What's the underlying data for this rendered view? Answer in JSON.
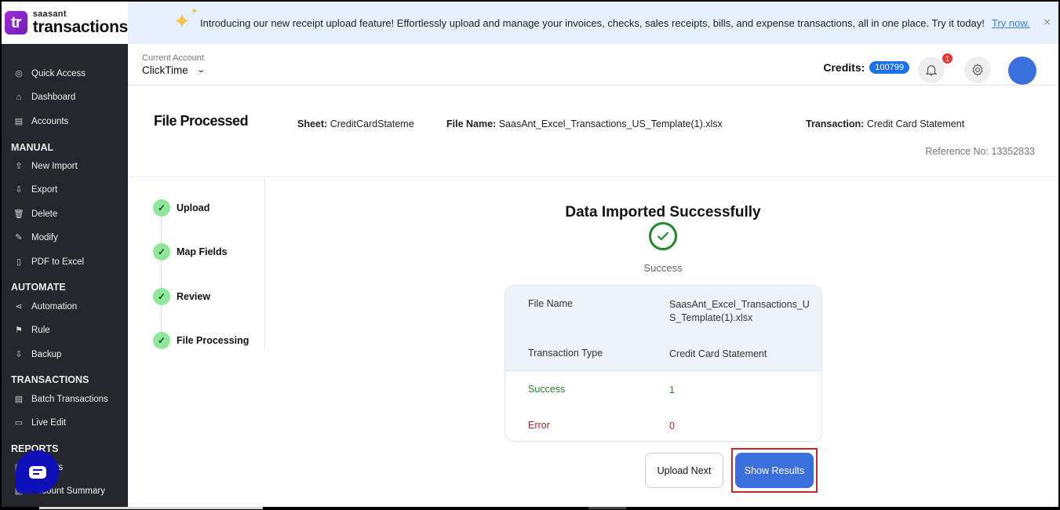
{
  "logo": {
    "mark": "tr",
    "small": "saasant",
    "big": "transactions"
  },
  "banner": {
    "text": "Introducing our new receipt upload feature! Effortlessly upload and manage your invoices, checks, sales receipts, bills, and expense transactions, all in one place. Try it today!",
    "link": "Try now.",
    "close": "×"
  },
  "sidebar": {
    "items": [
      {
        "label": "Quick Access",
        "icon": "◎"
      },
      {
        "label": "Dashboard",
        "icon": "⌂"
      },
      {
        "label": "Accounts",
        "icon": "▤"
      }
    ],
    "sections": [
      {
        "title": "MANUAL",
        "items": [
          {
            "label": "New Import",
            "icon": "⇧"
          },
          {
            "label": "Export",
            "icon": "⇩"
          },
          {
            "label": "Delete",
            "icon": "🗑"
          },
          {
            "label": "Modify",
            "icon": "✎"
          },
          {
            "label": "PDF to Excel",
            "icon": "▯"
          }
        ]
      },
      {
        "title": "AUTOMATE",
        "items": [
          {
            "label": "Automation",
            "icon": "⋖"
          },
          {
            "label": "Rule",
            "icon": "⚑"
          },
          {
            "label": "Backup",
            "icon": "⇩"
          }
        ]
      },
      {
        "title": "TRANSACTIONS",
        "items": [
          {
            "label": "Batch Transactions",
            "icon": "▤"
          },
          {
            "label": "Live Edit",
            "icon": "▭"
          }
        ]
      },
      {
        "title": "REPORTS",
        "items": [
          {
            "label": "Reports",
            "icon": "▤"
          },
          {
            "label": "Account Summary",
            "icon": "▤"
          }
        ]
      }
    ]
  },
  "header": {
    "account_label": "Current Account",
    "account_value": "ClickTime",
    "credits_label": "Credits:",
    "credits_value": "100799",
    "notification_count": "1"
  },
  "info": {
    "title": "File Processed",
    "sheet_label": "Sheet:",
    "sheet_value": "CreditCardStateme",
    "file_label": "File Name:",
    "file_value": "SaasAnt_Excel_Transactions_US_Template(1).xlsx",
    "transaction_label": "Transaction:",
    "transaction_value": "Credit Card Statement",
    "reference": "Reference No: 13352833"
  },
  "steps": [
    {
      "label": "Upload",
      "status": "done"
    },
    {
      "label": "Map Fields",
      "status": "done"
    },
    {
      "label": "Review",
      "status": "done"
    },
    {
      "label": "File Processing",
      "status": "done"
    }
  ],
  "result": {
    "title": "Data Imported Successfully",
    "status": "Success",
    "rows": [
      {
        "label": "File Name",
        "value": "SaasAnt_Excel_Transactions_US_Template(1).xlsx"
      },
      {
        "label": "Transaction Type",
        "value": "Credit Card Statement"
      },
      {
        "label": "Success",
        "value": "1"
      },
      {
        "label": "Error",
        "value": "0"
      }
    ]
  },
  "buttons": {
    "upload_next": "Upload Next",
    "show_results": "Show Results"
  },
  "colors": {
    "primary": "#3b6fde",
    "success": "#2e7d32",
    "error": "#b3262d",
    "step_done": "#8ee79a",
    "sidebar_bg": "#25272d",
    "banner_bg": "#e4f1fc"
  }
}
